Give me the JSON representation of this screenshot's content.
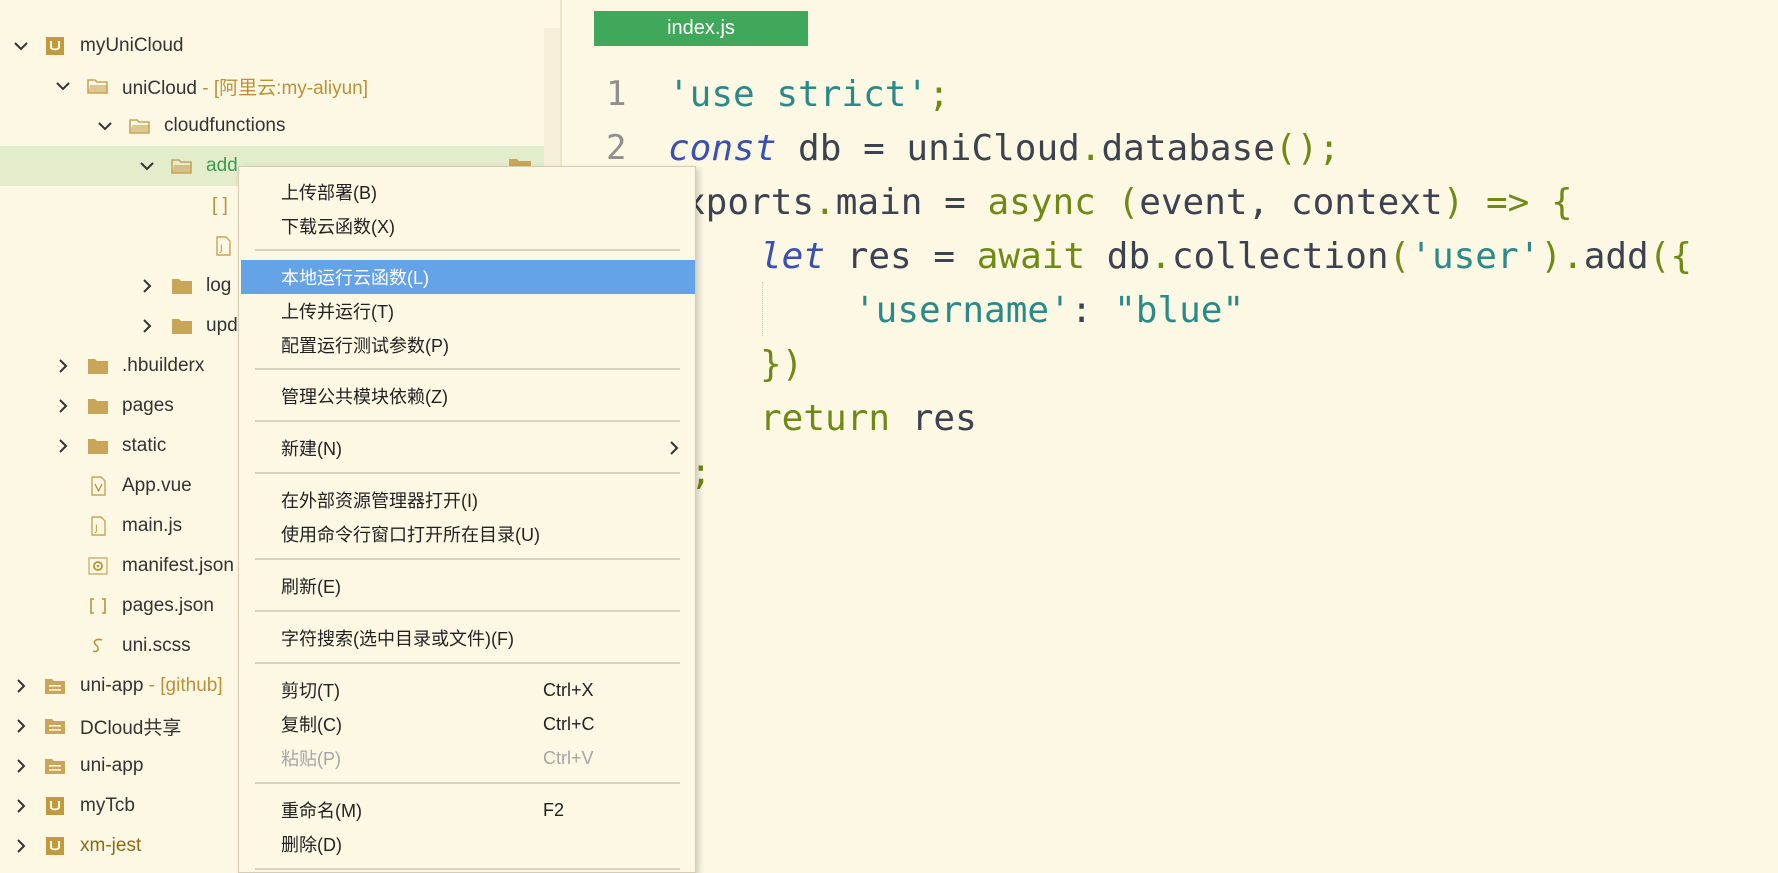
{
  "sidebar": {
    "items": [
      {
        "label": "myUniCloud",
        "tag": ""
      },
      {
        "label": "uniCloud",
        "tag": " - [阿里云:my-aliyun]"
      },
      {
        "label": "cloudfunctions",
        "tag": ""
      },
      {
        "label": "add",
        "tag": ""
      },
      {
        "label": "[ ]",
        "tag": ""
      },
      {
        "label": "",
        "tag": ""
      },
      {
        "label": "log",
        "tag": ""
      },
      {
        "label": "upd",
        "tag": ""
      },
      {
        "label": ".hbuilderx",
        "tag": ""
      },
      {
        "label": "pages",
        "tag": ""
      },
      {
        "label": "static",
        "tag": ""
      },
      {
        "label": "App.vue",
        "tag": ""
      },
      {
        "label": "main.js",
        "tag": ""
      },
      {
        "label": "manifest.json",
        "tag": ""
      },
      {
        "label": "pages.json",
        "tag": ""
      },
      {
        "label": "uni.scss",
        "tag": ""
      },
      {
        "label": "uni-app",
        "tag": " - [github]"
      },
      {
        "label": "DCloud共享",
        "tag": ""
      },
      {
        "label": "uni-app",
        "tag": ""
      },
      {
        "label": "myTcb",
        "tag": ""
      },
      {
        "label": "xm-jest",
        "tag": ""
      }
    ]
  },
  "editor": {
    "tab_label": "index.js",
    "line_numbers": [
      "1",
      "2"
    ],
    "code": {
      "l1_str": "'use strict'",
      "l1_semi": ";",
      "l2_const": "const",
      "l2_rest": " db = uniCloud",
      "l2_dot": ".",
      "l2_db": "database",
      "l2_paren": "();",
      "l3_exports": "xports",
      "l3_dot": ".",
      "l3_main": "main = ",
      "l3_async": "async",
      "l3_sp": " ",
      "l3_args_open": "(",
      "l3_args": "event, context",
      "l3_args_close": ")",
      "l3_arrow": " => {",
      "l4_let": "let",
      "l4_rest": " res = ",
      "l4_await": "await",
      "l4_db": " db",
      "l4_dot": ".",
      "l4_coll": "collection",
      "l4_paren_open": "(",
      "l4_user": "'user'",
      "l4_paren_close": ")",
      "l4_dot2": ".",
      "l4_add": "add",
      "l4_open": "({",
      "l5_key": "'username'",
      "l5_colon": ": ",
      "l5_val": "\"blue\"",
      "l6_close": "})",
      "l7_return": "return",
      "l7_res": " res",
      "l8_semi": ";"
    }
  },
  "context_menu": {
    "items": [
      {
        "label": "上传部署(B)",
        "shortcut": ""
      },
      {
        "label": "下载云函数(X)",
        "shortcut": ""
      },
      {
        "label": "本地运行云函数(L)",
        "shortcut": ""
      },
      {
        "label": "上传并运行(T)",
        "shortcut": ""
      },
      {
        "label": "配置运行测试参数(P)",
        "shortcut": ""
      },
      {
        "label": "管理公共模块依赖(Z)",
        "shortcut": ""
      },
      {
        "label": "新建(N)",
        "shortcut": ""
      },
      {
        "label": "在外部资源管理器打开(I)",
        "shortcut": ""
      },
      {
        "label": "使用命令行窗口打开所在目录(U)",
        "shortcut": ""
      },
      {
        "label": "刷新(E)",
        "shortcut": ""
      },
      {
        "label": "字符搜索(选中目录或文件)(F)",
        "shortcut": ""
      },
      {
        "label": "剪切(T)",
        "shortcut": "Ctrl+X"
      },
      {
        "label": "复制(C)",
        "shortcut": "Ctrl+C"
      },
      {
        "label": "粘贴(P)",
        "shortcut": "Ctrl+V"
      },
      {
        "label": "重命名(M)",
        "shortcut": "F2"
      },
      {
        "label": "删除(D)",
        "shortcut": ""
      }
    ]
  },
  "colors": {
    "background": "#fdf8e4",
    "tab_active": "#3fa85a",
    "menu_highlight": "#64a3e8",
    "selected_row": "#e3eccb",
    "folder_icon": "#c8a55a",
    "project_icon": "#c19a3e"
  }
}
